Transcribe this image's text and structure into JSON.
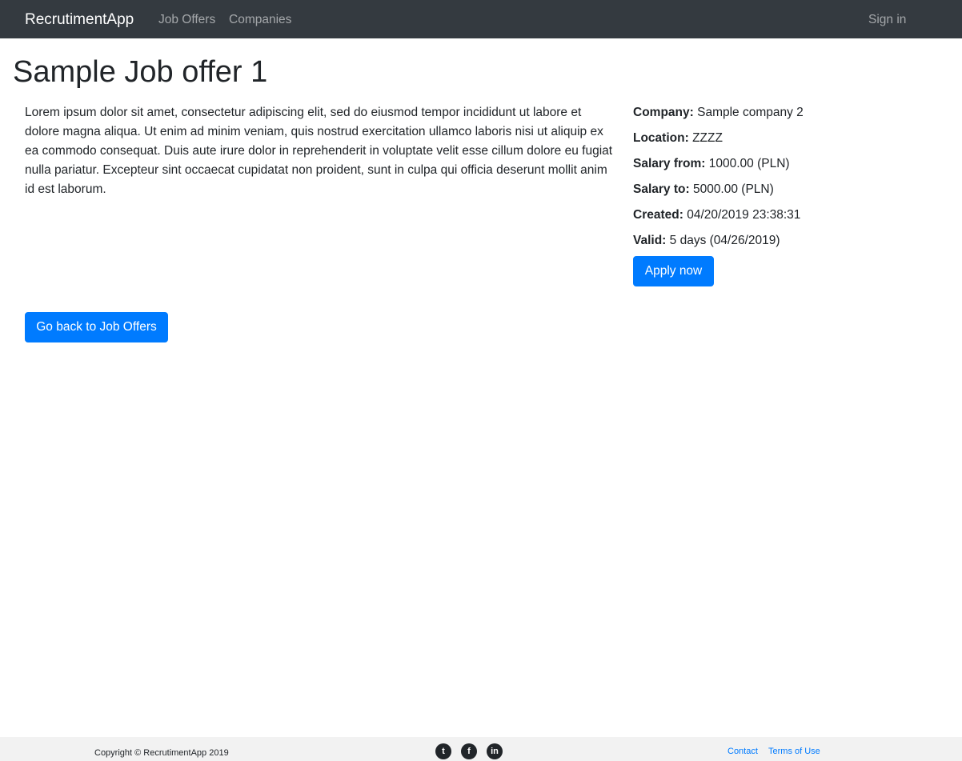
{
  "navbar": {
    "brand": "RecrutimentApp",
    "links": [
      {
        "label": "Job Offers"
      },
      {
        "label": "Companies"
      }
    ],
    "signin": "Sign in"
  },
  "offer": {
    "title": "Sample Job offer 1",
    "description": "Lorem ipsum dolor sit amet, consectetur adipiscing elit, sed do eiusmod tempor incididunt ut labore et dolore magna aliqua. Ut enim ad minim veniam, quis nostrud exercitation ullamco laboris nisi ut aliquip ex ea commodo consequat. Duis aute irure dolor in reprehenderit in voluptate velit esse cillum dolore eu fugiat nulla pariatur. Excepteur sint occaecat cupidatat non proident, sunt in culpa qui officia deserunt mollit anim id est laborum.",
    "details": [
      {
        "label": "Company:",
        "value": "Sample company 2"
      },
      {
        "label": "Location:",
        "value": "ZZZZ"
      },
      {
        "label": "Salary from:",
        "value": "1000.00 (PLN)"
      },
      {
        "label": "Salary to:",
        "value": "5000.00 (PLN)"
      },
      {
        "label": "Created:",
        "value": "04/20/2019 23:38:31"
      },
      {
        "label": "Valid:",
        "value": "5 days (04/26/2019)"
      }
    ],
    "apply_label": "Apply now",
    "back_label": "Go back to Job Offers"
  },
  "footer": {
    "copyright": "Copyright © RecrutimentApp 2019",
    "social": [
      {
        "icon": "twitter-icon",
        "glyph": "t"
      },
      {
        "icon": "facebook-icon",
        "glyph": "f"
      },
      {
        "icon": "linkedin-icon",
        "glyph": "in"
      }
    ],
    "links": [
      {
        "label": "Contact"
      },
      {
        "label": "Terms of Use"
      }
    ]
  },
  "colors": {
    "navbar": "#343a40",
    "primary": "#007bff",
    "footer": "#f2f2f2"
  }
}
